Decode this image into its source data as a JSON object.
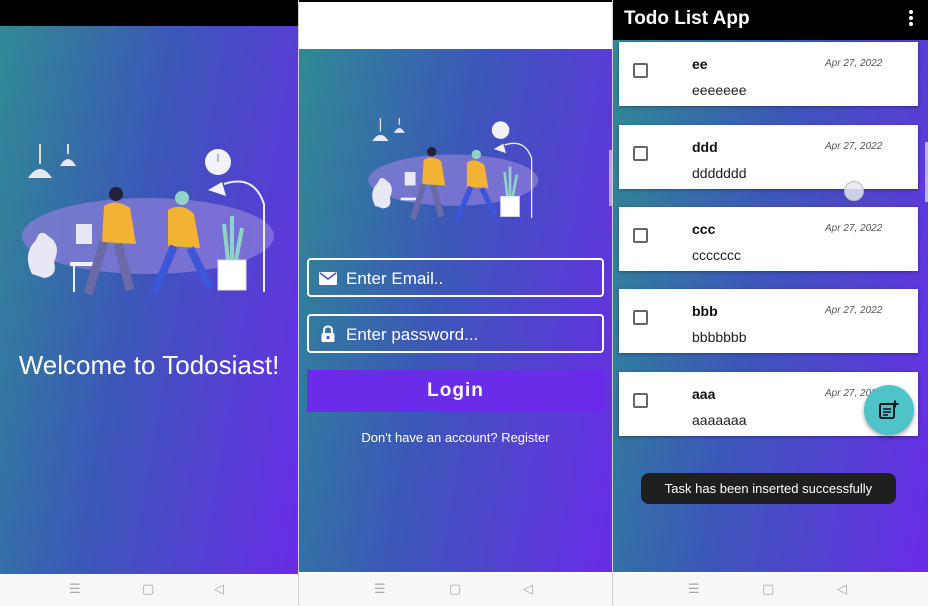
{
  "welcome_screen": {
    "welcome_text": "Welcome to Todosiast!",
    "illustration_icon": "people-dancing-illustration"
  },
  "login_screen": {
    "email_placeholder": "Enter Email..",
    "password_placeholder": "Enter password...",
    "email_icon": "envelope-icon",
    "password_icon": "lock-icon",
    "login_label": "Login",
    "register_prompt": "Don't have an account? Register"
  },
  "todo_screen": {
    "app_title": "Todo List App",
    "menu_icon": "more-vertical-icon",
    "tasks": [
      {
        "title": "ee",
        "description": "eeeeeee",
        "date": "Apr 27, 2022",
        "checked": false
      },
      {
        "title": "ddd",
        "description": "ddddddd",
        "date": "Apr 27, 2022",
        "checked": false
      },
      {
        "title": "ccc",
        "description": "ccccccc",
        "date": "Apr 27, 2022",
        "checked": false
      },
      {
        "title": "bbb",
        "description": "bbbbbbb",
        "date": "Apr 27, 2022",
        "checked": false
      },
      {
        "title": "aaa",
        "description": "aaaaaaa",
        "date": "Apr 27, 2022",
        "checked": false
      }
    ],
    "fab_icon": "add-note-icon",
    "toast": "Task has been inserted successfully"
  },
  "system_nav": {
    "menu_glyph": "☰",
    "home_glyph": "▢",
    "back_glyph": "◁"
  },
  "colors": {
    "gradient_start": "#2f8a93",
    "gradient_mid": "#3b57b8",
    "gradient_end": "#6a2ce8",
    "login_button": "#6a2ce8",
    "fab": "#4fc4c8",
    "toast_bg": "#1f1f1f"
  }
}
